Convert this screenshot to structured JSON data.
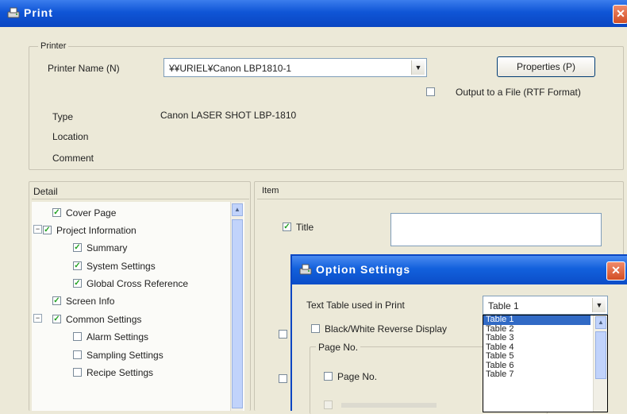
{
  "window": {
    "title": "Print",
    "close_glyph": "✕"
  },
  "printer": {
    "group_label": "Printer",
    "name_label": "Printer Name (N)",
    "name_value": "¥¥URIEL¥Canon LBP1810-1",
    "properties_label": "Properties (P)",
    "output_to_file_label": "Output to a File (RTF Format)",
    "type_label": "Type",
    "type_value": "Canon LASER SHOT LBP-1810",
    "location_label": "Location",
    "comment_label": "Comment"
  },
  "detail": {
    "header": "Detail",
    "items": [
      {
        "label": "Cover Page",
        "checked": true
      },
      {
        "label": "Project Information",
        "checked": true
      },
      {
        "label": "Summary",
        "checked": true
      },
      {
        "label": "System Settings",
        "checked": true
      },
      {
        "label": "Global Cross Reference",
        "checked": true
      },
      {
        "label": "Screen Info",
        "checked": true
      },
      {
        "label": "Common Settings",
        "checked": true
      },
      {
        "label": "Alarm Settings",
        "checked": false
      },
      {
        "label": "Sampling Settings",
        "checked": false
      },
      {
        "label": "Recipe Settings",
        "checked": false
      }
    ]
  },
  "item_panel": {
    "header": "Item",
    "title_label": "Title"
  },
  "option_dialog": {
    "title": "Option Settings",
    "close_glyph": "✕",
    "text_table_label": "Text Table used in Print",
    "selected": "Table 1",
    "options": [
      "Table 1",
      "Table 2",
      "Table 3",
      "Table 4",
      "Table 5",
      "Table 6",
      "Table 7"
    ],
    "bw_reverse_label": "Black/White Reverse Display",
    "page_no_group": "Page No.",
    "page_no_label": "Page No."
  },
  "icons": {
    "expand_minus": "−",
    "scroll_up": "▲",
    "dropdown": "▼",
    "check": "✓"
  },
  "colors": {
    "titlebar": "#0f55d6",
    "selection": "#316ac5",
    "close": "#d24e24"
  }
}
